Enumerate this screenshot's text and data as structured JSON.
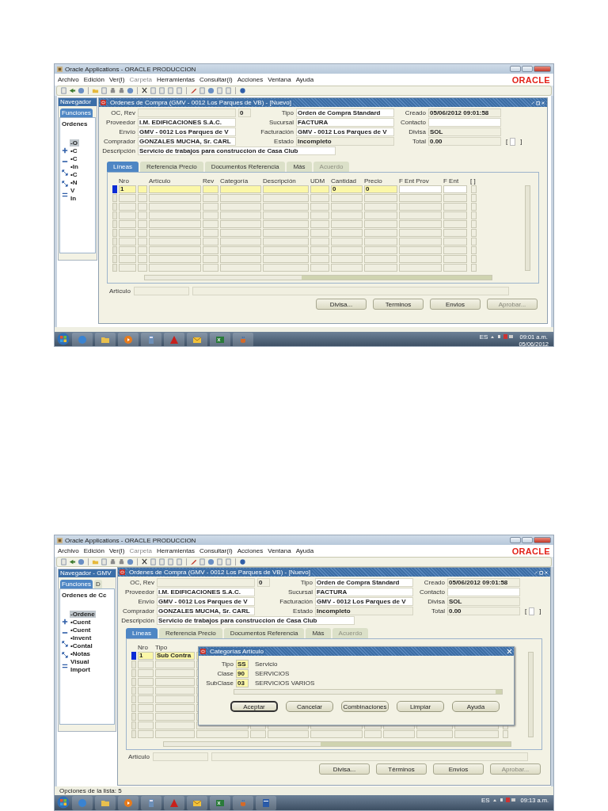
{
  "screenshots": [
    {
      "app_title": "Oracle Applications - ORACLE PRODUCCION",
      "logo": "ORACLE",
      "menu": [
        {
          "label": "Archivo",
          "disabled": false
        },
        {
          "label": "Edición",
          "disabled": false
        },
        {
          "label": "Ver(I)",
          "disabled": false
        },
        {
          "label": "Carpeta",
          "disabled": true
        },
        {
          "label": "Herramientas",
          "disabled": false
        },
        {
          "label": "Consultar(I)",
          "disabled": false
        },
        {
          "label": "Acciones",
          "disabled": false
        },
        {
          "label": "Ventana",
          "disabled": false
        },
        {
          "label": "Ayuda",
          "disabled": false
        }
      ],
      "navigator": {
        "title": "Navegador",
        "tabs": [
          {
            "label": "Funciones",
            "selected": true
          }
        ],
        "heading": "Ordenes",
        "items": [
          {
            "marker": "-",
            "label": "O",
            "selected": true
          },
          {
            "marker": "•",
            "label": "C",
            "selected": false
          },
          {
            "marker": "•",
            "label": "C",
            "selected": false
          },
          {
            "marker": "•",
            "label": "In",
            "selected": false
          },
          {
            "marker": "•",
            "label": "C",
            "selected": false
          },
          {
            "marker": "•",
            "label": "N",
            "selected": false
          },
          {
            "label": "V",
            "selected": false
          },
          {
            "label": "In",
            "selected": false
          }
        ]
      },
      "form": {
        "title": "Ordenes de Compra (GMV - 0012 Los Parques de VB) - [Nuevo]",
        "left": [
          {
            "label": "OC, Rev",
            "rev": "0"
          },
          {
            "label": "Proveedor",
            "value": "I.M. EDIFICACIONES S.A.C."
          },
          {
            "label": "Envío",
            "value": "GMV - 0012 Los Parques de V"
          },
          {
            "label": "Comprador",
            "value": "GONZALES MUCHA, Sr. CARL"
          },
          {
            "label": "Descripción",
            "value": "Servicio de trabajos para construccion de Casa Club"
          }
        ],
        "middle": [
          {
            "label": "Tipo",
            "value": "Orden de Compra Standard"
          },
          {
            "label": "Sucursal",
            "value": "FACTURA"
          },
          {
            "label": "Facturación",
            "value": "GMV - 0012 Los Parques de V"
          },
          {
            "label": "Estado",
            "value": "Incompleto"
          }
        ],
        "right": [
          {
            "label": "Creado",
            "value": "05/06/2012 09:01:58"
          },
          {
            "label": "Contacto"
          },
          {
            "label": "Divisa",
            "value": "SOL"
          },
          {
            "label": "Total",
            "value": "0.00",
            "check_left": "[",
            "check_right": "]",
            "checked": false
          }
        ],
        "tabs": [
          {
            "label": "Líneas",
            "selected": true,
            "disabled": false
          },
          {
            "label": "Referencia Precio",
            "selected": false,
            "disabled": false
          },
          {
            "label": "Documentos Referencia",
            "selected": false,
            "disabled": false
          },
          {
            "label": "Más",
            "selected": false,
            "disabled": false
          },
          {
            "label": "Acuerdo",
            "selected": false,
            "disabled": true
          }
        ],
        "columns": [
          {
            "label": "Nro",
            "first_value": "1"
          },
          {
            "label": "Artículo"
          },
          {
            "label": "Rev"
          },
          {
            "label": "Categoría"
          },
          {
            "label": "Descripción"
          },
          {
            "label": "UDM"
          },
          {
            "label": "Cantidad",
            "first_value": "0"
          },
          {
            "label": "Precio",
            "first_value": "0"
          },
          {
            "label": "F Ent Prov",
            "kind": "date"
          },
          {
            "label": "F Ent",
            "kind": "date"
          }
        ],
        "check_column": "[ ]",
        "article_label": "Artículo",
        "buttons": [
          {
            "label": "Divisa...",
            "disabled": false
          },
          {
            "label": "Terminos",
            "disabled": false
          },
          {
            "label": "Envios",
            "disabled": false
          },
          {
            "label": "Aprobar...",
            "disabled": true
          }
        ]
      },
      "taskbar": {
        "lang": "ES",
        "time": "09:01 a.m.",
        "date": "05/06/2012"
      }
    },
    {
      "app_title": "Oracle Applications - ORACLE PRODUCCION",
      "logo": "ORACLE",
      "menu": [
        {
          "label": "Archivo",
          "disabled": false
        },
        {
          "label": "Edición",
          "disabled": false
        },
        {
          "label": "Ver(I)",
          "disabled": false
        },
        {
          "label": "Carpeta",
          "disabled": true
        },
        {
          "label": "Herramientas",
          "disabled": false
        },
        {
          "label": "Consultar(I)",
          "disabled": false
        },
        {
          "label": "Acciones",
          "disabled": false
        },
        {
          "label": "Ventana",
          "disabled": false
        },
        {
          "label": "Ayuda",
          "disabled": false
        }
      ],
      "navigator": {
        "title": "Navegador - GMV",
        "tabs": [
          {
            "label": "Funciones",
            "selected": true
          },
          {
            "label": "D",
            "selected": false
          }
        ],
        "heading": "Ordenes de Cc",
        "items": [
          {
            "marker": "-",
            "label": "Ordene",
            "selected": true
          },
          {
            "marker": "•",
            "label": "Cuent",
            "selected": false
          },
          {
            "marker": "•",
            "label": "Cuent",
            "selected": false
          },
          {
            "marker": "•",
            "label": "Invent",
            "selected": false
          },
          {
            "marker": "•",
            "label": "Contal",
            "selected": false
          },
          {
            "marker": "•",
            "label": "Notas",
            "selected": false
          },
          {
            "label": "Visual",
            "selected": false
          },
          {
            "label": "Import",
            "selected": false
          }
        ]
      },
      "form": {
        "title": "Ordenes de Compra (GMV - 0012 Los Parques de VB) - [Nuevo]",
        "left": [
          {
            "label": "OC, Rev",
            "rev": "0"
          },
          {
            "label": "Proveedor",
            "value": "I.M. EDIFICACIONES S.A.C."
          },
          {
            "label": "Envío",
            "value": "GMV - 0012 Los Parques de V"
          },
          {
            "label": "Comprador",
            "value": "GONZALES MUCHA, Sr. CARL"
          },
          {
            "label": "Descripción",
            "value": "Servicio de trabajos para construccion de Casa Club"
          }
        ],
        "middle": [
          {
            "label": "Tipo",
            "value": "Orden de Compra Standard"
          },
          {
            "label": "Sucursal",
            "value": "FACTURA"
          },
          {
            "label": "Facturación",
            "value": "GMV - 0012 Los Parques de V"
          },
          {
            "label": "Estado",
            "value": "Incompleto"
          }
        ],
        "right": [
          {
            "label": "Creado",
            "value": "05/06/2012 09:01:58"
          },
          {
            "label": "Contacto"
          },
          {
            "label": "Divisa",
            "value": "SOL"
          },
          {
            "label": "Total",
            "value": "0.00",
            "check_left": "[",
            "check_right": "]",
            "checked": false
          }
        ],
        "tabs": [
          {
            "label": "Líneas",
            "selected": true,
            "disabled": false
          },
          {
            "label": "Referencia Precio",
            "selected": false,
            "disabled": false
          },
          {
            "label": "Documentos Referencia",
            "selected": false,
            "disabled": false
          },
          {
            "label": "Más",
            "selected": false,
            "disabled": false
          },
          {
            "label": "Acuerdo",
            "selected": false,
            "disabled": true
          }
        ],
        "columns": [
          {
            "label": "Nro",
            "first_value": "1"
          },
          {
            "label": "Tipo",
            "first_value": "Sub Contra"
          }
        ],
        "article_label": "Artículo",
        "buttons": [
          {
            "label": "Divisa...",
            "disabled": false
          },
          {
            "label": "Términos",
            "disabled": false
          },
          {
            "label": "Envíos",
            "disabled": false
          },
          {
            "label": "Aprobar...",
            "disabled": true
          }
        ]
      },
      "dialog": {
        "title": "Categorías Artículo",
        "rows": [
          {
            "label": "Tipo",
            "code": "SS",
            "description": "Servicio"
          },
          {
            "label": "Clase",
            "code": "90",
            "description": "SERVICIOS"
          },
          {
            "label": "SubClase",
            "code": "03",
            "description": "SERVICIOS VARIOS"
          }
        ],
        "buttons": [
          {
            "label": "Aceptar",
            "default": true
          },
          {
            "label": "Cancelar",
            "default": false
          },
          {
            "label": "Combinaciones",
            "default": false
          },
          {
            "label": "Limpiar",
            "default": false
          },
          {
            "label": "Ayuda",
            "default": false
          }
        ]
      },
      "status_text": "Opciones de la lista: 5",
      "taskbar": {
        "lang": "ES",
        "time": "09:13 a.m."
      }
    }
  ]
}
